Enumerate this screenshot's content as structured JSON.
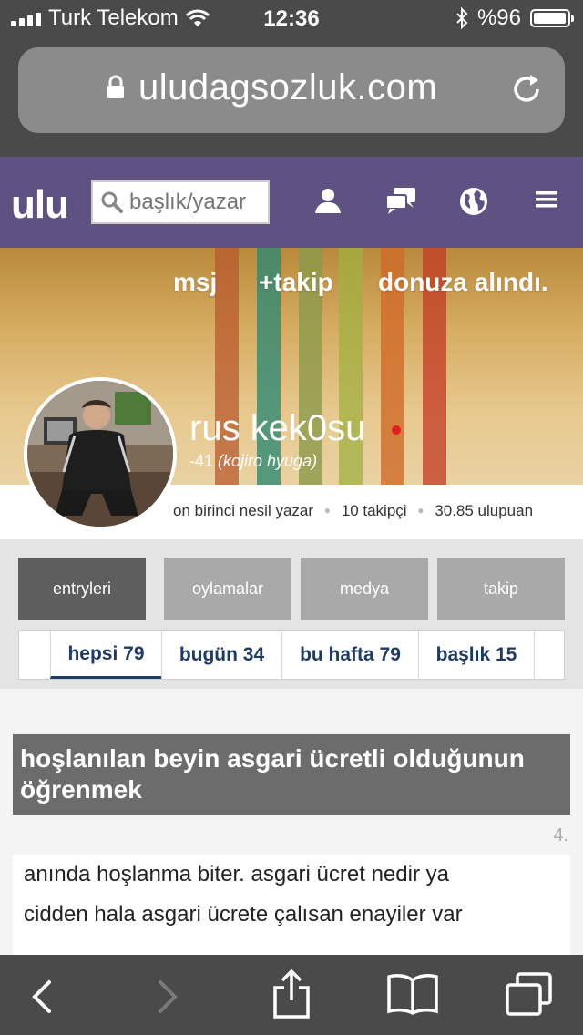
{
  "status_bar": {
    "carrier": "Turk Telekom",
    "time": "12:36",
    "battery_label": "%96",
    "battery_level": 0.96
  },
  "browser": {
    "url": "uludagsozluk.com"
  },
  "site": {
    "logo": "ulu",
    "search_placeholder": "başlık/yazar",
    "colors": {
      "nav_bg": "#5f5282",
      "active_tab": "#5e5e5e",
      "filter_text": "#1e3a66"
    }
  },
  "profile": {
    "actions": {
      "message": "msj",
      "follow": "+takip",
      "status": "donuza alındı."
    },
    "username": "rus kek0su",
    "score": "-41",
    "alias": "(kojiro hyuga)",
    "generation": "on birinci nesil yazar",
    "followers": "10 takipçi",
    "points": "30.85 ulupuan"
  },
  "tabs": [
    {
      "label": "entryleri",
      "active": true
    },
    {
      "label": "oylamalar",
      "active": false
    },
    {
      "label": "medya",
      "active": false
    },
    {
      "label": "takip",
      "active": false
    }
  ],
  "filters": [
    {
      "label": "hepsi 79",
      "active": true
    },
    {
      "label": "bugün 34",
      "active": false
    },
    {
      "label": "bu hafta 79",
      "active": false
    },
    {
      "label": "başlık 15",
      "active": false
    }
  ],
  "entry": {
    "title": "hoşlanılan beyin asgari ücretli olduğunun öğrenmek",
    "number": "4.",
    "body_lines": [
      "anında hoşlanma biter. asgari ücret nedir ya",
      "cidden hala asgari ücrete çalısan enayiler var"
    ]
  }
}
